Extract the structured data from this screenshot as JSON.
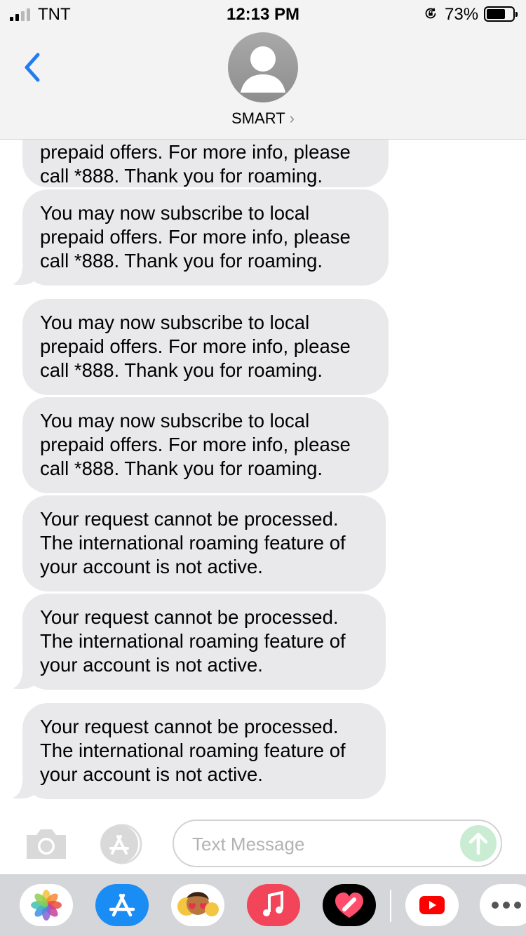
{
  "status_bar": {
    "carrier": "TNT",
    "time": "12:13 PM",
    "battery": "73%",
    "battery_level": 0.73
  },
  "header": {
    "contact_name": "SMART",
    "contact_chevron": "›"
  },
  "messages": [
    {
      "lines": [
        "prepaid offers. For more info, please",
        "call *888. Thank you for roaming."
      ]
    },
    {
      "lines": [
        "You may now subscribe to local",
        "prepaid offers. For more info, please",
        "call *888. Thank you for roaming."
      ]
    },
    {
      "lines": [
        "You may now subscribe to local",
        "prepaid offers. For more info, please",
        "call *888. Thank you for roaming."
      ]
    },
    {
      "lines": [
        "You may now subscribe to local",
        "prepaid offers. For more info, please",
        "call *888. Thank you for roaming."
      ]
    },
    {
      "lines": [
        "Your request cannot be processed.",
        "The international roaming feature of",
        "your account is not active."
      ]
    },
    {
      "lines": [
        "Your request cannot be processed.",
        "The international roaming feature of",
        "your account is not active."
      ]
    },
    {
      "lines": [
        "Your request cannot be processed.",
        "The international roaming feature of",
        "your account is not active."
      ]
    }
  ],
  "input": {
    "placeholder": "Text Message"
  },
  "drawer_apps": [
    {
      "name": "photos-icon"
    },
    {
      "name": "app-store-icon"
    },
    {
      "name": "memoji-icon"
    },
    {
      "name": "music-icon"
    },
    {
      "name": "heart-app-icon"
    },
    {
      "name": "youtube-icon"
    },
    {
      "name": "more-apps-icon"
    }
  ],
  "colors": {
    "accent_blue": "#1f7cf2",
    "bubble_gray": "#e9e9eb",
    "send_disabled": "#c9ecd2"
  }
}
